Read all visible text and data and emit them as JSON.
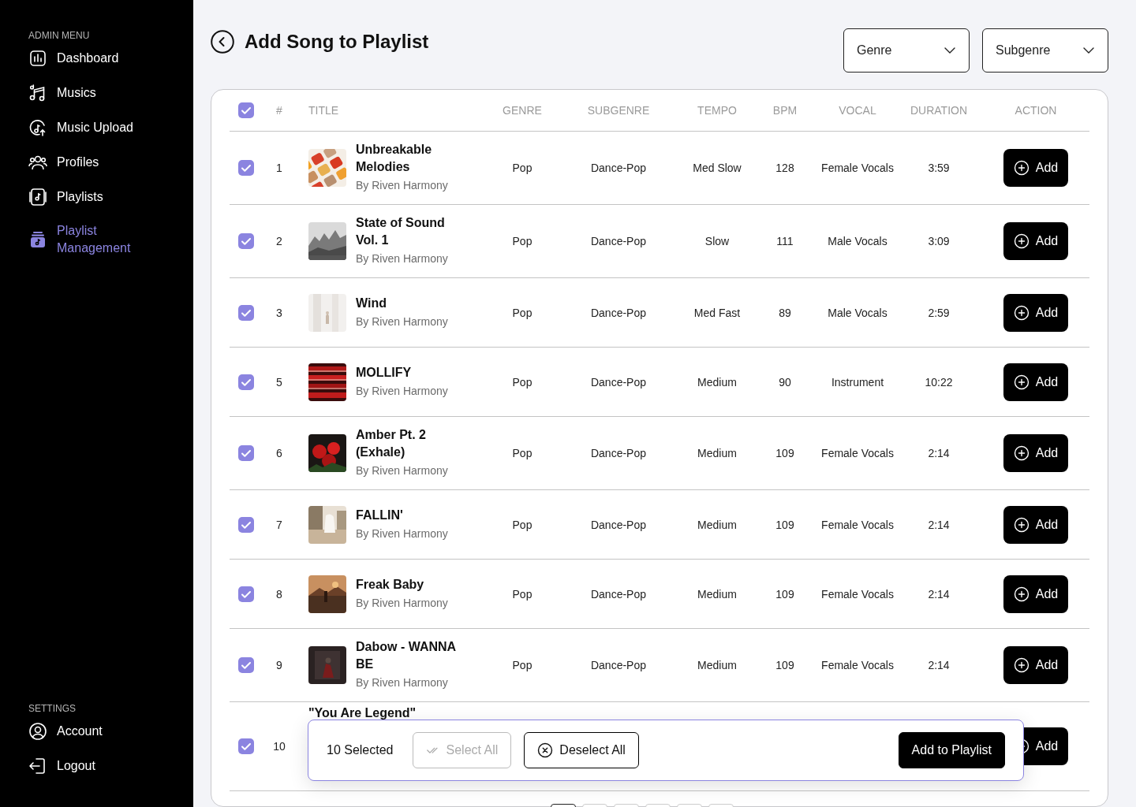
{
  "sidebar": {
    "sections": [
      {
        "heading": "ADMIN MENU",
        "items": [
          {
            "label": "Dashboard",
            "selected": false
          },
          {
            "label": "Musics",
            "selected": false
          },
          {
            "label": "Music Upload",
            "selected": false
          },
          {
            "label": "Profiles",
            "selected": false
          },
          {
            "label": "Playlists",
            "selected": false
          },
          {
            "label": "Playlist Management",
            "selected": true
          }
        ]
      },
      {
        "heading": "SETTINGS",
        "items": [
          {
            "label": "Account",
            "selected": false
          },
          {
            "label": "Logout",
            "selected": false
          }
        ]
      }
    ]
  },
  "header": {
    "title": "Add Song to Playlist",
    "filters": [
      {
        "label": "Genre"
      },
      {
        "label": "Subgenre"
      }
    ]
  },
  "table": {
    "all_checked": true,
    "columns": [
      "#",
      "TITLE",
      "GENRE",
      "SUBGENRE",
      "TEMPO",
      "BPM",
      "VOCAL",
      "DURATION",
      "ACTION"
    ],
    "rows": [
      {
        "checked": true,
        "number": "1",
        "title": "Unbreakable Melodies",
        "artist": "By Riven Harmony",
        "genre": "Pop",
        "subgenre": "Dance-Pop",
        "tempo": "Med Slow",
        "bpm": "128",
        "vocal": "Female Vocals",
        "duration": "3:59",
        "action": "Add"
      },
      {
        "checked": true,
        "number": "2",
        "title": "State of Sound Vol. 1",
        "artist": "By Riven Harmony",
        "genre": "Pop",
        "subgenre": "Dance-Pop",
        "tempo": "Slow",
        "bpm": "111",
        "vocal": "Male Vocals",
        "duration": "3:09",
        "action": "Add"
      },
      {
        "checked": true,
        "number": "3",
        "title": "Wind",
        "artist": "By Riven Harmony",
        "genre": "Pop",
        "subgenre": "Dance-Pop",
        "tempo": "Med Fast",
        "bpm": "89",
        "vocal": "Male Vocals",
        "duration": "2:59",
        "action": "Add"
      },
      {
        "checked": true,
        "number": "5",
        "title": "MOLLIFY",
        "artist": "By Riven Harmony",
        "genre": "Pop",
        "subgenre": "Dance-Pop",
        "tempo": "Medium",
        "bpm": "90",
        "vocal": "Instrument",
        "duration": "10:22",
        "action": "Add"
      },
      {
        "checked": true,
        "number": "6",
        "title": "Amber Pt. 2 (Exhale)",
        "artist": "By Riven Harmony",
        "genre": "Pop",
        "subgenre": "Dance-Pop",
        "tempo": "Medium",
        "bpm": "109",
        "vocal": "Female Vocals",
        "duration": "2:14",
        "action": "Add"
      },
      {
        "checked": true,
        "number": "7",
        "title": "FALLIN'",
        "artist": "By Riven Harmony",
        "genre": "Pop",
        "subgenre": "Dance-Pop",
        "tempo": "Medium",
        "bpm": "109",
        "vocal": "Female Vocals",
        "duration": "2:14",
        "action": "Add"
      },
      {
        "checked": true,
        "number": "8",
        "title": "Freak Baby",
        "artist": "By Riven Harmony",
        "genre": "Pop",
        "subgenre": "Dance-Pop",
        "tempo": "Medium",
        "bpm": "109",
        "vocal": "Female Vocals",
        "duration": "2:14",
        "action": "Add"
      },
      {
        "checked": true,
        "number": "9",
        "title": "Dabow - WANNA BE",
        "artist": "By Riven Harmony",
        "genre": "Pop",
        "subgenre": "Dance-Pop",
        "tempo": "Medium",
        "bpm": "109",
        "vocal": "Female Vocals",
        "duration": "2:14",
        "action": "Add"
      },
      {
        "checked": true,
        "number": "10",
        "title": "\"You Are Legend\"",
        "action": "Add"
      }
    ]
  },
  "selection_bar": {
    "count": "10 Selected",
    "buttons": [
      {
        "label": "Select All",
        "kind": "select",
        "disabled": true
      },
      {
        "label": "Deselect All",
        "kind": "deselect",
        "disabled": false
      },
      {
        "label": "Add to Playlist",
        "kind": "primary",
        "disabled": false
      }
    ]
  },
  "pagination": {
    "pages": [
      {
        "selected": true
      },
      {
        "selected": false
      },
      {
        "selected": false
      },
      {
        "selected": false
      },
      {
        "selected": false
      },
      {
        "selected": false
      }
    ]
  }
}
